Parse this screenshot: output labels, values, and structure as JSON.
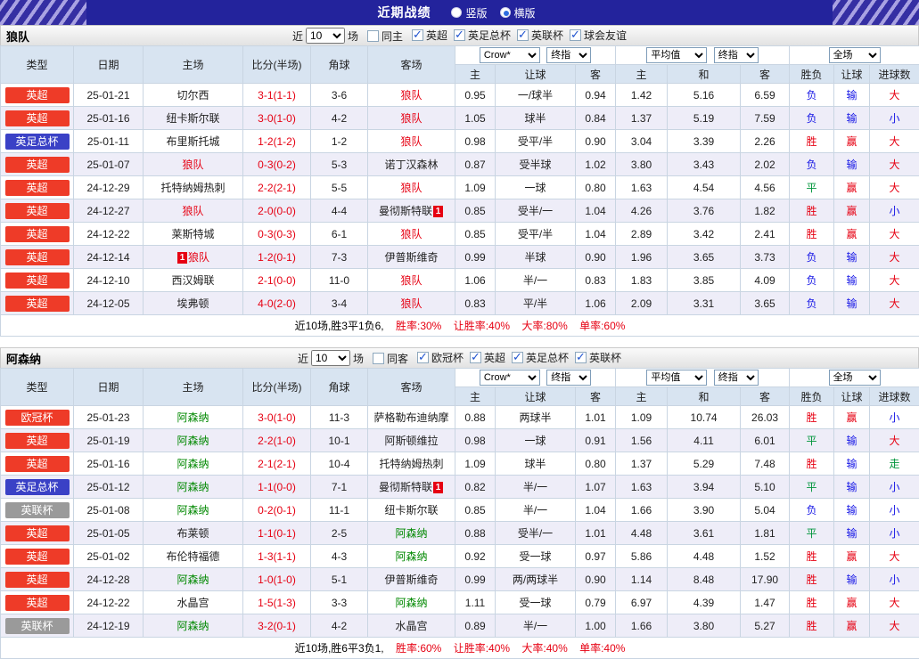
{
  "topbar": {
    "title": "近期战绩",
    "layout_options": [
      {
        "label": "竖版",
        "checked": false
      },
      {
        "label": "横版",
        "checked": true
      }
    ]
  },
  "header": {
    "cols": [
      "类型",
      "日期",
      "主场",
      "比分(半场)",
      "角球",
      "客场"
    ],
    "odds_selects": [
      "Crow*",
      "终指"
    ],
    "avg_selects": [
      "平均值",
      "终指"
    ],
    "full_select": "全场",
    "odds_cols": [
      "主",
      "让球",
      "客"
    ],
    "avg_cols": [
      "主",
      "和",
      "客"
    ],
    "result_cols": [
      "胜负",
      "让球",
      "进球数"
    ]
  },
  "colors": {
    "league": {
      "英超": "#ee3b28",
      "英足总杯": "#3a41c6",
      "英联杯": "#9a9a9a",
      "欧冠杯": "#ee3b28"
    },
    "result": {
      "胜": "#e60012",
      "赢": "#e60012",
      "大": "#e60012",
      "平": "#00953b",
      "走": "#00953b",
      "负": "#1717e6",
      "输": "#1717e6",
      "小": "#1717e6"
    },
    "score": "#e60012"
  },
  "sections": [
    {
      "team": "狼队",
      "team_color": "#e60012",
      "near_label": "近",
      "count": "10",
      "games_label": "场",
      "same_label": "同主",
      "same_checked": false,
      "filters": [
        {
          "label": "英超",
          "checked": true
        },
        {
          "label": "英足总杯",
          "checked": true
        },
        {
          "label": "英联杯",
          "checked": true
        },
        {
          "label": "球会友谊",
          "checked": true
        }
      ],
      "rows": [
        [
          "英超",
          "25-01-21",
          {
            "t": "切尔西"
          },
          "3-1(1-1)",
          "3-6",
          {
            "t": "狼队",
            "f": 1
          },
          "0.95",
          "一/球半",
          "0.94",
          "1.42",
          "5.16",
          "6.59",
          "负",
          "输",
          "大"
        ],
        [
          "英超",
          "25-01-16",
          {
            "t": "纽卡斯尔联"
          },
          "3-0(1-0)",
          "4-2",
          {
            "t": "狼队",
            "f": 1
          },
          "1.05",
          "球半",
          "0.84",
          "1.37",
          "5.19",
          "7.59",
          "负",
          "输",
          "小"
        ],
        [
          "英足总杯",
          "25-01-11",
          {
            "t": "布里斯托城"
          },
          "1-2(1-2)",
          "1-2",
          {
            "t": "狼队",
            "f": 1
          },
          "0.98",
          "受平/半",
          "0.90",
          "3.04",
          "3.39",
          "2.26",
          "胜",
          "赢",
          "大"
        ],
        [
          "英超",
          "25-01-07",
          {
            "t": "狼队",
            "f": 1
          },
          "0-3(0-2)",
          "5-3",
          {
            "t": "诺丁汉森林"
          },
          "0.87",
          "受半球",
          "1.02",
          "3.80",
          "3.43",
          "2.02",
          "负",
          "输",
          "大"
        ],
        [
          "英超",
          "24-12-29",
          {
            "t": "托特纳姆热刺"
          },
          "2-2(2-1)",
          "5-5",
          {
            "t": "狼队",
            "f": 1
          },
          "1.09",
          "一球",
          "0.80",
          "1.63",
          "4.54",
          "4.56",
          "平",
          "赢",
          "大"
        ],
        [
          "英超",
          "24-12-27",
          {
            "t": "狼队",
            "f": 1
          },
          "2-0(0-0)",
          "4-4",
          {
            "t": "曼彻斯特联",
            "c": "after"
          },
          "0.85",
          "受半/一",
          "1.04",
          "4.26",
          "3.76",
          "1.82",
          "胜",
          "赢",
          "小"
        ],
        [
          "英超",
          "24-12-22",
          {
            "t": "莱斯特城"
          },
          "0-3(0-3)",
          "6-1",
          {
            "t": "狼队",
            "f": 1
          },
          "0.85",
          "受平/半",
          "1.04",
          "2.89",
          "3.42",
          "2.41",
          "胜",
          "赢",
          "大"
        ],
        [
          "英超",
          "24-12-14",
          {
            "t": "狼队",
            "f": 1,
            "c": "before"
          },
          "1-2(0-1)",
          "7-3",
          {
            "t": "伊普斯维奇"
          },
          "0.99",
          "半球",
          "0.90",
          "1.96",
          "3.65",
          "3.73",
          "负",
          "输",
          "大"
        ],
        [
          "英超",
          "24-12-10",
          {
            "t": "西汉姆联"
          },
          "2-1(0-0)",
          "11-0",
          {
            "t": "狼队",
            "f": 1
          },
          "1.06",
          "半/一",
          "0.83",
          "1.83",
          "3.85",
          "4.09",
          "负",
          "输",
          "大"
        ],
        [
          "英超",
          "24-12-05",
          {
            "t": "埃弗顿"
          },
          "4-0(2-0)",
          "3-4",
          {
            "t": "狼队",
            "f": 1
          },
          "0.83",
          "平/半",
          "1.06",
          "2.09",
          "3.31",
          "3.65",
          "负",
          "输",
          "大"
        ]
      ],
      "footer": {
        "summary": "近10场,胜3平1负6,",
        "stats": [
          "胜率:30%",
          "让胜率:40%",
          "大率:80%",
          "单率:60%"
        ]
      }
    },
    {
      "team": "阿森纳",
      "team_color": "#008800",
      "near_label": "近",
      "count": "10",
      "games_label": "场",
      "same_label": "同客",
      "same_checked": false,
      "filters": [
        {
          "label": "欧冠杯",
          "checked": true
        },
        {
          "label": "英超",
          "checked": true
        },
        {
          "label": "英足总杯",
          "checked": true
        },
        {
          "label": "英联杯",
          "checked": true
        }
      ],
      "rows": [
        [
          "欧冠杯",
          "25-01-23",
          {
            "t": "阿森纳",
            "f": 1
          },
          "3-0(1-0)",
          "11-3",
          {
            "t": "萨格勒布迪纳摩"
          },
          "0.88",
          "两球半",
          "1.01",
          "1.09",
          "10.74",
          "26.03",
          "胜",
          "赢",
          "小"
        ],
        [
          "英超",
          "25-01-19",
          {
            "t": "阿森纳",
            "f": 1
          },
          "2-2(1-0)",
          "10-1",
          {
            "t": "阿斯顿维拉"
          },
          "0.98",
          "一球",
          "0.91",
          "1.56",
          "4.11",
          "6.01",
          "平",
          "输",
          "大"
        ],
        [
          "英超",
          "25-01-16",
          {
            "t": "阿森纳",
            "f": 1
          },
          "2-1(2-1)",
          "10-4",
          {
            "t": "托特纳姆热刺"
          },
          "1.09",
          "球半",
          "0.80",
          "1.37",
          "5.29",
          "7.48",
          "胜",
          "输",
          "走"
        ],
        [
          "英足总杯",
          "25-01-12",
          {
            "t": "阿森纳",
            "f": 1
          },
          "1-1(0-0)",
          "7-1",
          {
            "t": "曼彻斯特联",
            "c": "after"
          },
          "0.82",
          "半/一",
          "1.07",
          "1.63",
          "3.94",
          "5.10",
          "平",
          "输",
          "小"
        ],
        [
          "英联杯",
          "25-01-08",
          {
            "t": "阿森纳",
            "f": 1
          },
          "0-2(0-1)",
          "11-1",
          {
            "t": "纽卡斯尔联"
          },
          "0.85",
          "半/一",
          "1.04",
          "1.66",
          "3.90",
          "5.04",
          "负",
          "输",
          "小"
        ],
        [
          "英超",
          "25-01-05",
          {
            "t": "布莱顿"
          },
          "1-1(0-1)",
          "2-5",
          {
            "t": "阿森纳",
            "f": 1
          },
          "0.88",
          "受半/一",
          "1.01",
          "4.48",
          "3.61",
          "1.81",
          "平",
          "输",
          "小"
        ],
        [
          "英超",
          "25-01-02",
          {
            "t": "布伦特福德"
          },
          "1-3(1-1)",
          "4-3",
          {
            "t": "阿森纳",
            "f": 1
          },
          "0.92",
          "受一球",
          "0.97",
          "5.86",
          "4.48",
          "1.52",
          "胜",
          "赢",
          "大"
        ],
        [
          "英超",
          "24-12-28",
          {
            "t": "阿森纳",
            "f": 1
          },
          "1-0(1-0)",
          "5-1",
          {
            "t": "伊普斯维奇"
          },
          "0.99",
          "两/两球半",
          "0.90",
          "1.14",
          "8.48",
          "17.90",
          "胜",
          "输",
          "小"
        ],
        [
          "英超",
          "24-12-22",
          {
            "t": "水晶宫"
          },
          "1-5(1-3)",
          "3-3",
          {
            "t": "阿森纳",
            "f": 1
          },
          "1.11",
          "受一球",
          "0.79",
          "6.97",
          "4.39",
          "1.47",
          "胜",
          "赢",
          "大"
        ],
        [
          "英联杯",
          "24-12-19",
          {
            "t": "阿森纳",
            "f": 1
          },
          "3-2(0-1)",
          "4-2",
          {
            "t": "水晶宫"
          },
          "0.89",
          "半/一",
          "1.00",
          "1.66",
          "3.80",
          "5.27",
          "胜",
          "赢",
          "大"
        ]
      ],
      "footer": {
        "summary": "近10场,胜6平3负1,",
        "stats": [
          "胜率:60%",
          "让胜率:40%",
          "大率:40%",
          "单率:40%"
        ]
      }
    }
  ]
}
